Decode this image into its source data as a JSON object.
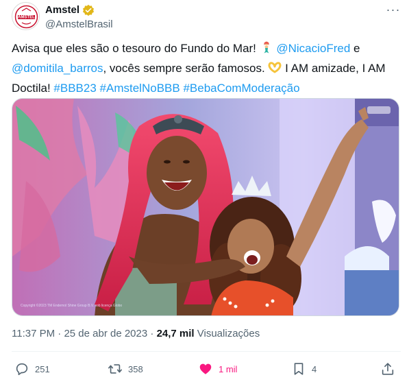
{
  "author": {
    "display_name": "Amstel",
    "handle": "@AmstelBrasil",
    "avatar_text": "AMSTEL",
    "verified_icon": "verified-badge-icon",
    "more_label": "···"
  },
  "tweet": {
    "text_1": "Avisa que eles são o tesouro do Fundo do Mar! ",
    "emoji_1": "mermaid-emoji",
    "mention_1": "@NicacioFred",
    "text_2": " e ",
    "mention_2": "@domitila_barros",
    "text_3": ", vocês sempre serão famosos. ",
    "emoji_2": "heart-hands-emoji",
    "text_4": " I AM amizade, I AM Doctila! ",
    "hashtag_1": "#BBB23",
    "hashtag_2": "#AmstelNoBBB",
    "hashtag_3": "#BebaComModeração"
  },
  "media": {
    "watermark": "Copyright ©2023 TM Endemol Shine Group B.V. sob licença Globo"
  },
  "meta": {
    "time": "11:37 PM",
    "separator": " · ",
    "date": "25 de abr de 2023",
    "views_count": "24,7 mil",
    "views_label": " Visualizações"
  },
  "actions": {
    "replies": "251",
    "reposts": "358",
    "likes": "1 mil",
    "bookmarks": "4"
  },
  "colors": {
    "link": "#1d9bf0",
    "like": "#f91880",
    "secondary_text": "#536471",
    "verified": "#e2b719"
  }
}
